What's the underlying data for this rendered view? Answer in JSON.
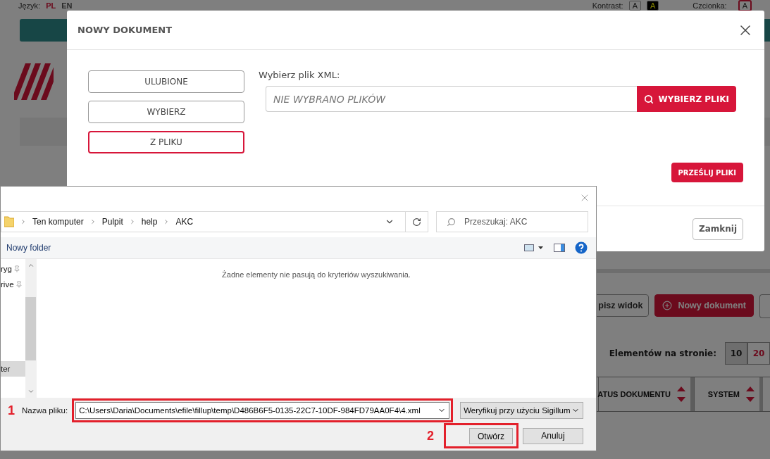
{
  "background": {
    "language_label": "Język:",
    "languages": [
      {
        "label": "PL",
        "selected": true
      },
      {
        "label": "EN",
        "selected": false
      }
    ],
    "contrast_label": "Kontrast:",
    "contrast_options": [
      {
        "label": "A",
        "kind": "normal"
      },
      {
        "label": "A",
        "kind": "inverted"
      }
    ],
    "font_label": "Czcionka:",
    "font_option": "A",
    "toolbar_buttons": [
      {
        "label": "pisz widok",
        "kind": "outline"
      },
      {
        "label": "Nowy dokument",
        "kind": "primary"
      }
    ],
    "per_page_label": "Elementów na stronie:",
    "per_page_options": [
      {
        "label": "10",
        "selected": true
      },
      {
        "label": "20",
        "selected": false
      }
    ],
    "table_columns": [
      "ATUS DOKUMENTU",
      "SYSTEM"
    ]
  },
  "modal": {
    "title": "NOWY DOKUMENT",
    "options": [
      {
        "label": "ULUBIONE",
        "selected": false
      },
      {
        "label": "WYBIERZ",
        "selected": false
      },
      {
        "label": "Z PLIKU",
        "selected": true
      }
    ],
    "file_label": "Wybierz plik XML:",
    "file_placeholder": "NIE WYBRANO PLIKÓW",
    "choose_button": "WYBIERZ PLIKI",
    "upload_button": "PRZEŚLIJ PLIKI",
    "close_button": "Zamknij"
  },
  "file_dialog": {
    "breadcrumb": [
      "Ten komputer",
      "Pulpit",
      "help",
      "AKC"
    ],
    "search_placeholder": "Przeszukaj: AKC",
    "new_folder": "Nowy folder",
    "nav_items": [
      {
        "label": "ryg",
        "pinned": true,
        "selected": false
      },
      {
        "label": "rive",
        "pinned": true,
        "selected": false
      },
      {
        "label": "ter",
        "pinned": false,
        "selected": true
      }
    ],
    "empty_message": "Żadne elementy nie pasują do kryteriów wyszukiwania.",
    "filename_label": "Nazwa pliku:",
    "filename_value": "C:\\Users\\Daria\\Documents\\efile\\fillup\\temp\\D486B6F5-0135-22C7-10DF-984FD79AA0F4\\4.xml",
    "filetype": "Weryfikuj przy użyciu Sigillum",
    "open_button": "Otwórz",
    "cancel_button": "Anuluj"
  },
  "annotations": [
    "1",
    "2"
  ]
}
